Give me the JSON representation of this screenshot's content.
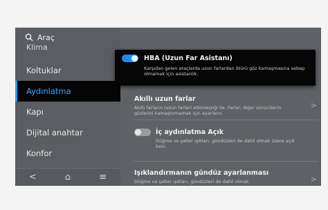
{
  "search": {
    "label": "Araç"
  },
  "sidebar": {
    "items": [
      {
        "label": "Klima",
        "cut": true
      },
      {
        "label": "Koltuklar"
      },
      {
        "label": "Aydınlatma",
        "active": true
      },
      {
        "label": "Kapı"
      },
      {
        "label": "Dijital anahtar"
      },
      {
        "label": "Konfor"
      }
    ]
  },
  "navbar": {
    "back": "<",
    "home": "⌂",
    "menu": "≡"
  },
  "hba": {
    "title": "HBA (Uzun Far Asistanı)",
    "description": "Karşıdan gelen araçlarda uzun farlardan ötürü göz kamaşmasına sebep olmamak için asistanlık.",
    "enabled": true
  },
  "cards": [
    {
      "title": "Akıllı uzun farlar",
      "description": "Akıllı farların (uzun farlar) etkinleştiği ile, Farlar, diğer sürücülerin gözlerini kamaştırmamak için ayarlanır.",
      "chevron": ">"
    },
    {
      "title": "İç aydınlatma Açık",
      "description": "Düğme ve şalter ışıkları, gündüzleri de dahil olmak üzere açık kalır.",
      "enabled": false
    },
    {
      "title": "Işıklandırmanın gündüz ayarlanması",
      "description": "Düğme ve şalter ışıkları, gündüzleri de dahil olmak",
      "chevron": ">"
    }
  ],
  "colors": {
    "accent": "#1aa0ff",
    "active_text": "#3fa9ff",
    "screen_bg": "#5e6165"
  }
}
